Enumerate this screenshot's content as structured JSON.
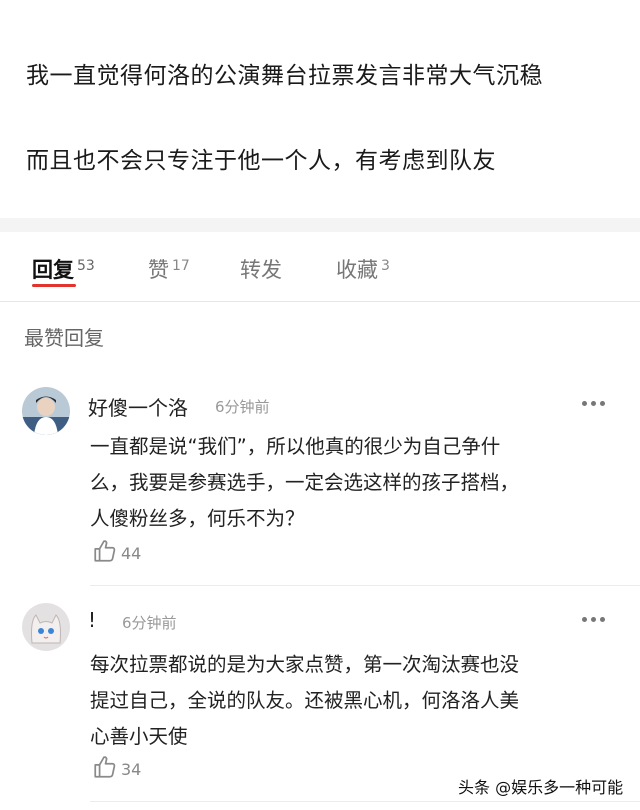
{
  "post": {
    "line1": "我一直觉得何洛的公演舞台拉票发言非常大气沉稳",
    "line2": "而且也不会只专注于他一个人，有考虑到队友"
  },
  "tabs": [
    {
      "label": "回复",
      "count": "53"
    },
    {
      "label": "赞",
      "count": "17"
    },
    {
      "label": "转发",
      "count": ""
    },
    {
      "label": "收藏",
      "count": "3"
    }
  ],
  "section_title": "最赞回复",
  "comments": [
    {
      "username": "好傻一个洛",
      "time": "6分钟前",
      "lines": [
        "一直都是说“我们”，所以他真的很少为自己争什",
        "么，我要是参赛选手，一定会选这样的孩子搭档，",
        "人傻粉丝多，何乐不为？"
      ],
      "likes": "44",
      "icons": {
        "avatar": "user-avatar-photo",
        "more": "more-dots-icon",
        "like": "thumbs-up-icon"
      }
    },
    {
      "username": "!",
      "time": "6分钟前",
      "lines": [
        "每次拉票都说的是为大家点赞，第一次淘汰赛也没",
        "提过自己，全说的队友。还被黑心机，何洛洛人美",
        "心善小天使"
      ],
      "likes": "34",
      "icons": {
        "avatar": "user-avatar-cat",
        "more": "more-dots-icon",
        "like": "thumbs-up-icon"
      }
    }
  ],
  "watermark": "头条 @娱乐多一种可能",
  "colors": {
    "accent": "#e0342c",
    "muted": "#999999",
    "text": "#222222",
    "background": "#ffffff"
  }
}
